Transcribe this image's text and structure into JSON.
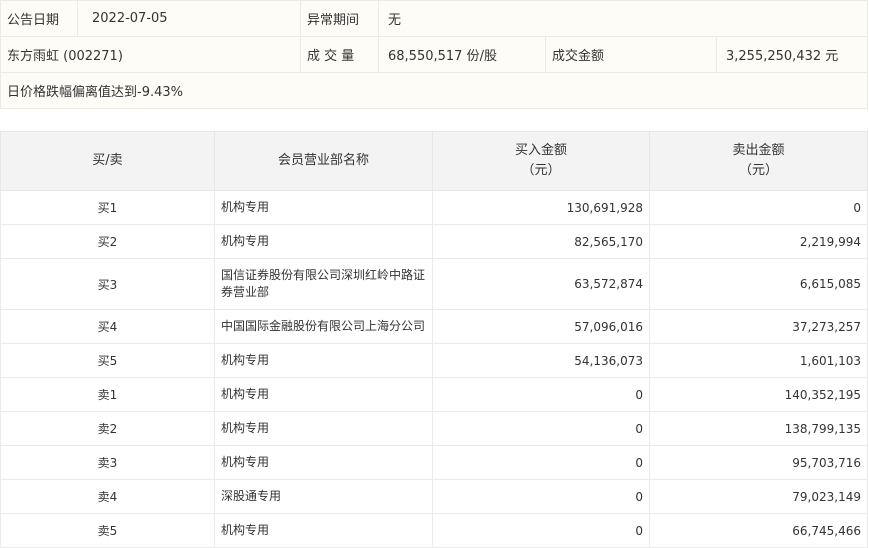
{
  "info": {
    "announce_date_label": "公告日期",
    "announce_date": "2022-07-05",
    "abnormal_period_label": "异常期间",
    "abnormal_period": "无",
    "stock_name": "东方雨虹 (002271)",
    "volume_label": "成 交 量",
    "volume": "68,550,517 份/股",
    "amount_label": "成交金额",
    "amount": "3,255,250,432 元",
    "reason": "日价格跌幅偏离值达到-9.43%"
  },
  "table": {
    "headers": {
      "side": "买/卖",
      "dept": "会员营业部名称",
      "buy_line1": "买入金额",
      "buy_line2": "（元）",
      "sell_line1": "卖出金额",
      "sell_line2": "（元）"
    },
    "rows": [
      {
        "side": "买1",
        "dept": "机构专用",
        "buy": "130,691,928",
        "sell": "0"
      },
      {
        "side": "买2",
        "dept": "机构专用",
        "buy": "82,565,170",
        "sell": "2,219,994"
      },
      {
        "side": "买3",
        "dept": "国信证券股份有限公司深圳红岭中路证券营业部",
        "buy": "63,572,874",
        "sell": "6,615,085"
      },
      {
        "side": "买4",
        "dept": "中国国际金融股份有限公司上海分公司",
        "buy": "57,096,016",
        "sell": "37,273,257"
      },
      {
        "side": "买5",
        "dept": "机构专用",
        "buy": "54,136,073",
        "sell": "1,601,103"
      },
      {
        "side": "卖1",
        "dept": "机构专用",
        "buy": "0",
        "sell": "140,352,195"
      },
      {
        "side": "卖2",
        "dept": "机构专用",
        "buy": "0",
        "sell": "138,799,135"
      },
      {
        "side": "卖3",
        "dept": "机构专用",
        "buy": "0",
        "sell": "95,703,716"
      },
      {
        "side": "卖4",
        "dept": "深股通专用",
        "buy": "0",
        "sell": "79,023,149"
      },
      {
        "side": "卖5",
        "dept": "机构专用",
        "buy": "0",
        "sell": "66,745,466"
      }
    ]
  }
}
